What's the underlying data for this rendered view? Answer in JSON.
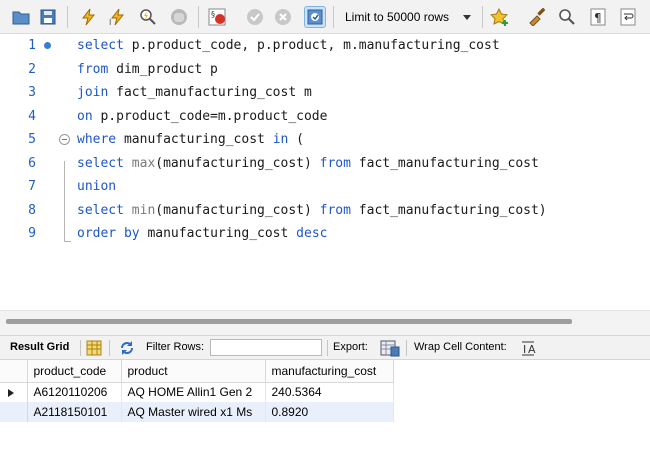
{
  "toolbar": {
    "limit_label": "Limit to 50000 rows",
    "icons": [
      "open-folder-icon",
      "save-icon",
      "execute-icon",
      "execute-current-icon",
      "explain-icon",
      "stop-icon",
      "toggle-stop-on-error-icon",
      "commit-icon",
      "rollback-icon",
      "toggle-autocommit-icon",
      "limit-dropdown",
      "beautify-icon",
      "clean-icon",
      "find-icon",
      "invisible-chars-icon",
      "wrap-icon"
    ]
  },
  "editor": {
    "lines": [
      {
        "num": "1",
        "tokens": [
          {
            "t": "kw",
            "v": "select"
          },
          {
            "t": "tx",
            "v": " p.product_code, p.product, m.manufacturing_cost"
          }
        ]
      },
      {
        "num": "2",
        "tokens": [
          {
            "t": "kw",
            "v": "from"
          },
          {
            "t": "tx",
            "v": " dim_product p"
          }
        ]
      },
      {
        "num": "3",
        "tokens": [
          {
            "t": "kw",
            "v": "join"
          },
          {
            "t": "tx",
            "v": " fact_manufacturing_cost m"
          }
        ]
      },
      {
        "num": "4",
        "tokens": [
          {
            "t": "kw",
            "v": "on"
          },
          {
            "t": "tx",
            "v": " p.product_code=m.product_code"
          }
        ]
      },
      {
        "num": "5",
        "tokens": [
          {
            "t": "kw",
            "v": "where"
          },
          {
            "t": "tx",
            "v": " manufacturing_cost "
          },
          {
            "t": "kw",
            "v": "in"
          },
          {
            "t": "tx",
            "v": " ("
          }
        ]
      },
      {
        "num": "6",
        "tokens": [
          {
            "t": "kw",
            "v": "select"
          },
          {
            "t": "tx",
            "v": " "
          },
          {
            "t": "fn",
            "v": "max"
          },
          {
            "t": "tx",
            "v": "(manufacturing_cost) "
          },
          {
            "t": "kw",
            "v": "from"
          },
          {
            "t": "tx",
            "v": " fact_manufacturing_cost"
          }
        ]
      },
      {
        "num": "7",
        "tokens": [
          {
            "t": "kw",
            "v": "union"
          }
        ]
      },
      {
        "num": "8",
        "tokens": [
          {
            "t": "kw",
            "v": "select"
          },
          {
            "t": "tx",
            "v": " "
          },
          {
            "t": "fn",
            "v": "min"
          },
          {
            "t": "tx",
            "v": "(manufacturing_cost) "
          },
          {
            "t": "kw",
            "v": "from"
          },
          {
            "t": "tx",
            "v": " fact_manufacturing_cost)"
          }
        ]
      },
      {
        "num": "9",
        "tokens": [
          {
            "t": "kw",
            "v": "order by"
          },
          {
            "t": "tx",
            "v": " manufacturing_cost "
          },
          {
            "t": "kw",
            "v": "desc"
          }
        ]
      }
    ]
  },
  "results_toolbar": {
    "result_grid_label": "Result Grid",
    "filter_rows_label": "Filter Rows:",
    "filter_value": "",
    "export_label": "Export:",
    "wrap_label": "Wrap Cell Content:"
  },
  "grid": {
    "columns": [
      "product_code",
      "product",
      "manufacturing_cost"
    ],
    "rows": [
      [
        "A6120110206",
        "AQ HOME Allin1 Gen 2",
        "240.5364"
      ],
      [
        "A2118150101",
        "AQ Master wired x1 Ms",
        "0.8920"
      ]
    ]
  }
}
